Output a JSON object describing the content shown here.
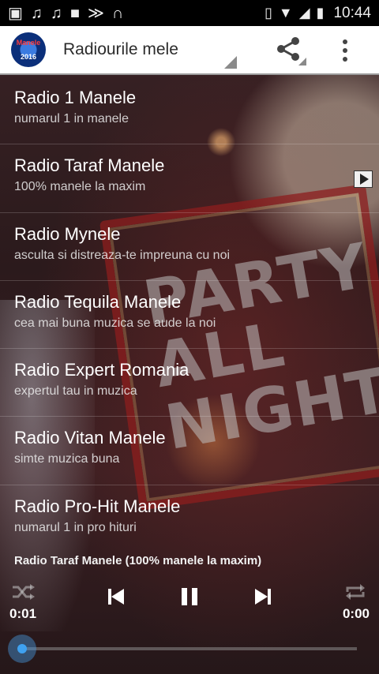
{
  "status_bar": {
    "time": "10:44",
    "icons": [
      "image-icon",
      "music-note-icon",
      "music-note-icon",
      "blank-square-icon",
      "fish-icon",
      "headphones-icon",
      "vibrate-icon",
      "wifi-icon",
      "signal-icon",
      "battery-icon"
    ]
  },
  "app_bar": {
    "logo_text": "Manele",
    "logo_year": "2016",
    "title": "Radiourile mele"
  },
  "stations": [
    {
      "name": "Radio 1 Manele",
      "desc": "numarul 1 in manele"
    },
    {
      "name": "Radio Taraf Manele",
      "desc": "100% manele la maxim"
    },
    {
      "name": "Radio Mynele",
      "desc": "asculta si distreaza-te impreuna cu noi"
    },
    {
      "name": "Radio Tequila Manele",
      "desc": "cea mai buna muzica se aude la noi"
    },
    {
      "name": "Radio Expert Romania",
      "desc": "expertul tau in muzica"
    },
    {
      "name": "Radio Vitan Manele",
      "desc": "simte muzica buna"
    },
    {
      "name": "Radio Pro-Hit Manele",
      "desc": "numarul 1 in pro hituri"
    }
  ],
  "player": {
    "now_playing": "Radio Taraf Manele (100% manele la maxim)",
    "elapsed": "0:01",
    "duration": "0:00",
    "progress": 0
  },
  "background_sign": {
    "text": "PARTY ALL NIGHT"
  },
  "colors": {
    "accent": "#3fa1f0",
    "app_bar": "#ffffff",
    "title": "#2b2b2b"
  }
}
